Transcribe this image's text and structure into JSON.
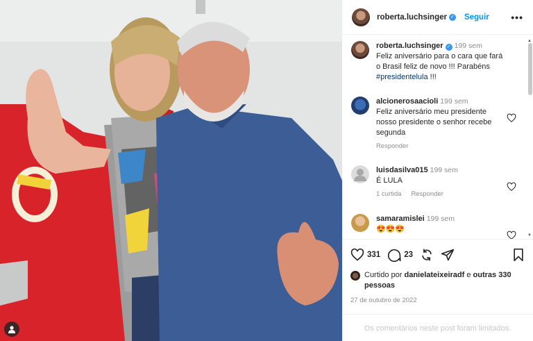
{
  "post": {
    "author": "roberta.luchsinger",
    "follow_label": "Seguir",
    "more_label": "•••"
  },
  "comments": [
    {
      "name": "roberta.luchsinger",
      "time": "199 sem",
      "text_pre": "Feliz aniversário para o cara que fará o Brasil feliz de novo !!! Parabéns ",
      "tag": "#presidentelula",
      "text_post": " !!!",
      "verified": true
    },
    {
      "name": "alcionerosaacioli",
      "time": "199 sem",
      "text": "Feliz aniversário meu presidente nosso presidente o senhor recebe segunda",
      "reply": "Responder"
    },
    {
      "name": "luisdasilva015",
      "time": "199 sem",
      "text": "É LULA",
      "likes": "1 curtida",
      "reply": "Responder"
    },
    {
      "name": "samaramislei",
      "time": "199 sem",
      "text": "😍😍😍"
    }
  ],
  "stats": {
    "likes": "331",
    "comments": "23"
  },
  "liked_by": {
    "prefix": "Curtido por ",
    "user": "danielateixeiradf",
    "middle": " e ",
    "others": "outras 330 pessoas"
  },
  "date": "27 de outubro de 2022",
  "limited_notice": "Os comentários neste post foram limitados."
}
